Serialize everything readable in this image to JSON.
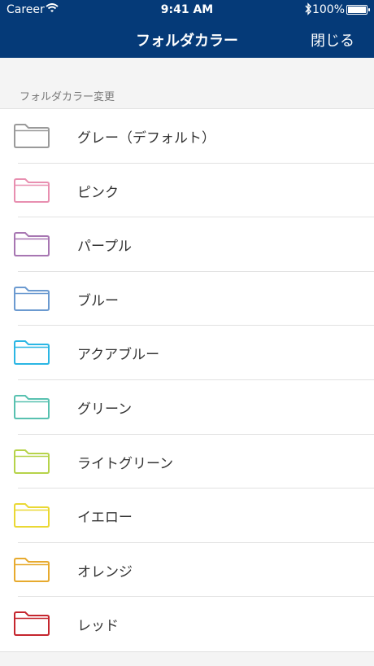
{
  "status": {
    "carrier": "Career",
    "time": "9:41 AM",
    "battery": "100%"
  },
  "nav": {
    "title": "フォルダカラー",
    "close": "閉じる"
  },
  "section": {
    "title": "フォルダカラー変更"
  },
  "colors": [
    {
      "label": "グレー（デフォルト）",
      "color": "#9a9a9a"
    },
    {
      "label": "ピンク",
      "color": "#e88fb0"
    },
    {
      "label": "パープル",
      "color": "#a776b2"
    },
    {
      "label": "ブルー",
      "color": "#6b9ad0"
    },
    {
      "label": "アクアブルー",
      "color": "#2bb6e4"
    },
    {
      "label": "グリーン",
      "color": "#58c1b0"
    },
    {
      "label": "ライトグリーン",
      "color": "#b6d34a"
    },
    {
      "label": "イエロー",
      "color": "#ead834"
    },
    {
      "label": "オレンジ",
      "color": "#e7aa2e"
    },
    {
      "label": "レッド",
      "color": "#c5262e"
    }
  ]
}
